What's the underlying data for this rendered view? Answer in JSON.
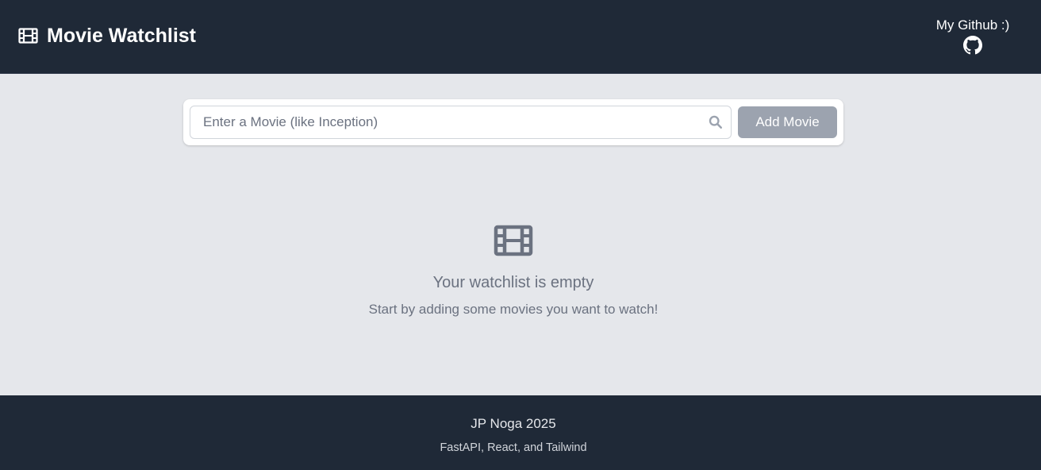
{
  "header": {
    "title": "Movie Watchlist",
    "brand_icon": "film-icon",
    "github_label": "My Github :)",
    "github_icon": "github-icon"
  },
  "search": {
    "placeholder": "Enter a Movie (like Inception)",
    "value": "",
    "icon": "search-icon",
    "button_label": "Add Movie"
  },
  "empty_state": {
    "icon": "film-icon",
    "title": "Your watchlist is empty",
    "subtitle": "Start by adding some movies you want to watch!"
  },
  "footer": {
    "name": "JP Noga 2025",
    "stack": "FastAPI, React, and Tailwind"
  },
  "colors": {
    "header_bg": "#1f2937",
    "page_bg": "#e5e7eb",
    "button_bg": "#9ca3af",
    "muted_text": "#6b7280"
  }
}
